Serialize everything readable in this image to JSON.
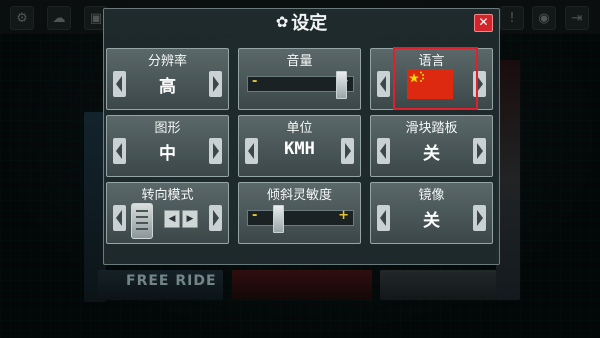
{
  "background": {
    "free_ride_label": "FREE RIDE"
  },
  "dialog": {
    "title": "设定",
    "close_icon": "close-icon",
    "title_icon": "gear-icon"
  },
  "panels": {
    "resolution": {
      "label": "分辨率",
      "value": "高"
    },
    "volume": {
      "label": "音量",
      "level": 1.0
    },
    "language": {
      "label": "语言",
      "value_icon": "china-flag-icon"
    },
    "graphics": {
      "label": "图形",
      "value": "中"
    },
    "units": {
      "label": "单位",
      "value": "KMH"
    },
    "slider_pedal": {
      "label": "滑块踏板",
      "value": "关"
    },
    "steering_mode": {
      "label": "转向模式"
    },
    "tilt_sensitivity": {
      "label": "倾斜灵敏度",
      "level": 0.15
    },
    "mirror": {
      "label": "镜像",
      "value": "关"
    }
  },
  "colors": {
    "accent_yellow": "#e6c431",
    "close_red": "#d4242b",
    "highlight_red": "#e0202a"
  }
}
